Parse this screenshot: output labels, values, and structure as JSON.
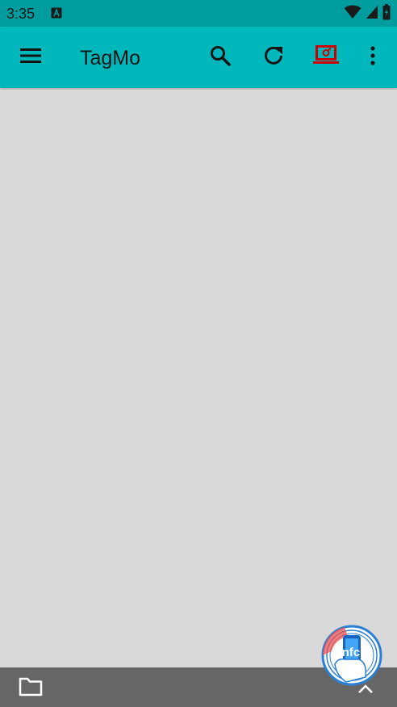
{
  "status_bar": {
    "time": "3:35",
    "app_icon": "a-square-icon",
    "icons": [
      "wifi-icon",
      "cell-signal-icon",
      "battery-charging-icon"
    ]
  },
  "toolbar": {
    "title": "TagMo",
    "menu_icon": "hamburger-menu-icon",
    "search_icon": "search-icon",
    "refresh_icon": "refresh-icon",
    "device_icon": "device-laptop-icon",
    "overflow_icon": "more-vert-icon",
    "device_icon_color": "#d00000"
  },
  "bottom_bar": {
    "folder_icon": "folder-icon",
    "expand_icon": "chevron-up-icon"
  },
  "nfc_button": {
    "label": "nfc",
    "colors": {
      "ring": "#2a7fd6",
      "phone": "#1565c0",
      "accent": "#ef5350"
    }
  },
  "colors": {
    "status_bar": "#009c9e",
    "toolbar": "#00b8bb",
    "content_bg": "#d9d9d9",
    "bottom_bar": "#666666"
  }
}
